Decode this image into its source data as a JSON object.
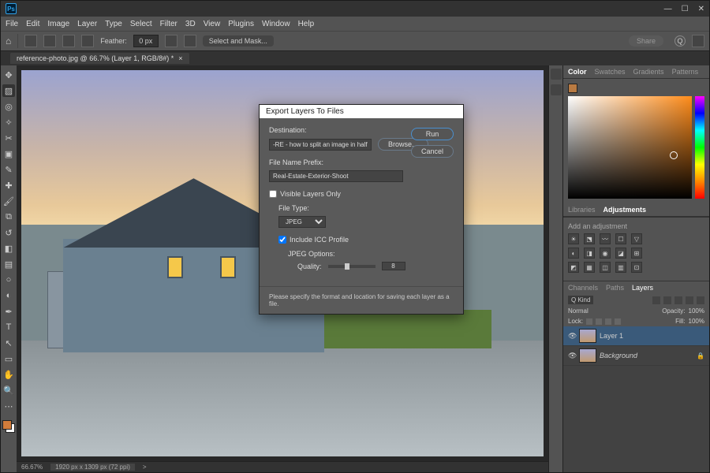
{
  "app": {
    "logo": "Ps"
  },
  "menus": [
    "File",
    "Edit",
    "Image",
    "Layer",
    "Type",
    "Select",
    "Filter",
    "3D",
    "View",
    "Plugins",
    "Window",
    "Help"
  ],
  "options": {
    "feather_label": "Feather:",
    "feather_value": "0 px",
    "select_mask": "Select and Mask...",
    "share": "Share"
  },
  "tab": {
    "title": "reference-photo.jpg @ 66.7% (Layer 1, RGB/8#) *",
    "close": "×"
  },
  "status": {
    "zoom": "66.67%",
    "docinfo": "1920 px x 1309 px (72 ppi)",
    "arrow": ">"
  },
  "panels": {
    "color_tabs": [
      "Color",
      "Swatches",
      "Gradients",
      "Patterns"
    ],
    "lib_tabs": [
      "Libraries",
      "Adjustments"
    ],
    "adj_title": "Add an adjustment",
    "layer_tabs": [
      "Channels",
      "Paths",
      "Layers"
    ],
    "filter_kind": "Q Kind",
    "blend": "Normal",
    "opacity_label": "Opacity:",
    "opacity_value": "100%",
    "lock_label": "Lock:",
    "fill_label": "Fill:",
    "fill_value": "100%",
    "layers": [
      {
        "name": "Layer 1",
        "locked": false
      },
      {
        "name": "Background",
        "locked": true
      }
    ]
  },
  "dialog": {
    "title": "Export Layers To Files",
    "destination_label": "Destination:",
    "destination_value": "-RE - how to split an image in half",
    "browse": "Browse...",
    "run": "Run",
    "cancel": "Cancel",
    "prefix_label": "File Name Prefix:",
    "prefix_value": "Real-Estate-Exterior-Shoot",
    "visible_only": "Visible Layers Only",
    "filetype_label": "File Type:",
    "filetype_value": "JPEG",
    "include_icc": "Include ICC Profile",
    "jpeg_options": "JPEG Options:",
    "quality_label": "Quality:",
    "quality_value": "8",
    "footer": "Please specify the format and location for saving each layer as a file."
  }
}
